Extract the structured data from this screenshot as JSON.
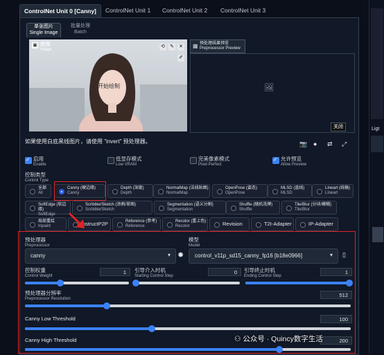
{
  "tabs": [
    "ControlNet Unit 0 [Canny]",
    "ControlNet Unit 1",
    "ControlNet Unit 2",
    "ControlNet Unit 3"
  ],
  "image_tabs": [
    {
      "cn": "单张图片",
      "en": "Single Image"
    },
    {
      "cn": "批量处理",
      "en": "Batch"
    }
  ],
  "image": {
    "label_cn": "图像",
    "label_en": "Image",
    "canvas_text": "开始绘制",
    "invert_btn": "关闭",
    "preview_btn_cn": "预处理结果预览",
    "preview_btn_en": "Preprocessor Preview"
  },
  "hint": "如果使用白底黑线图片，请使用 \"invert\" 预处理器。",
  "checkboxes": [
    {
      "cn": "启用",
      "en": "Enable",
      "checked": true
    },
    {
      "cn": "低显存模式",
      "en": "Low VRAM",
      "checked": false
    },
    {
      "cn": "完美像素模式",
      "en": "Pixel Perfect",
      "checked": false
    },
    {
      "cn": "允许预览",
      "en": "Allow Preview",
      "checked": true
    }
  ],
  "control_type": {
    "label_cn": "控制类型",
    "label_en": "Control Type",
    "selected": "Canny",
    "row1": [
      {
        "cn": "全部",
        "en": "All"
      },
      {
        "cn": "Canny (硬边缘)",
        "en": "Canny"
      },
      {
        "cn": "Depth (深度)",
        "en": "Depth"
      },
      {
        "cn": "NormalMap (法线贴图)",
        "en": "NormalMap"
      },
      {
        "cn": "OpenPose (姿态)",
        "en": "OpenPose"
      },
      {
        "cn": "MLSD (直线)",
        "en": "MLSD"
      },
      {
        "cn": "Lineart (线稿)",
        "en": "Lineart"
      }
    ],
    "row2": [
      {
        "cn": "SoftEdge (软边缘)",
        "en": "SoftEdge"
      },
      {
        "cn": "Scribble/Sketch (涂鸦/草图)",
        "en": "Scribble/Sketch"
      },
      {
        "cn": "Segmentation (语义分割)",
        "en": "Segmentation"
      },
      {
        "cn": "Shuffle (随机洗牌)",
        "en": "Shuffle"
      },
      {
        "cn": "Tile/Blur (分块/模糊)",
        "en": "Tile/Blur"
      }
    ],
    "row3": [
      {
        "cn": "局部重绘",
        "en": "Inpaint"
      },
      {
        "cn": "InstructP2P",
        "en": ""
      },
      {
        "cn": "Reference (参考)",
        "en": "Reference"
      },
      {
        "cn": "Recolor (重上色)",
        "en": "Recolor"
      },
      {
        "cn": "Revision",
        "en": ""
      },
      {
        "cn": "T2I-Adapter",
        "en": ""
      },
      {
        "cn": "IP-Adapter",
        "en": ""
      }
    ]
  },
  "preprocessor": {
    "label_cn": "预处理器",
    "label_en": "Preprocessor",
    "value": "canny"
  },
  "model": {
    "label_cn": "模型",
    "label_en": "Model",
    "value": "control_v11p_sd15_canny_fp16 [b18e0966]"
  },
  "sliders": {
    "weight": {
      "cn": "控制权重",
      "en": "Control Weight",
      "value": "1",
      "fraction": 0.34
    },
    "start": {
      "cn": "引导介入时机",
      "en": "Starting Control Step",
      "value": "0",
      "fraction": 0.0
    },
    "end": {
      "cn": "引导终止时机",
      "en": "Ending Control Step",
      "value": "1",
      "fraction": 1.0
    },
    "resolution": {
      "cn": "预处理器分辨率",
      "en": "Preprocessor Resolution",
      "value": "512",
      "fraction": 0.25
    },
    "low": {
      "cn": "Canny Low Threshold",
      "value": "100",
      "fraction": 0.39
    },
    "high": {
      "cn": "Canny High Threshold",
      "value": "200",
      "fraction": 0.78
    }
  },
  "right_panel": {
    "label": "Ligt"
  },
  "watermark": "公众号 · Quincy数字生活",
  "colors": {
    "accent": "#3b82f6",
    "annotation": "#e02424",
    "background": "#0b0f19"
  }
}
